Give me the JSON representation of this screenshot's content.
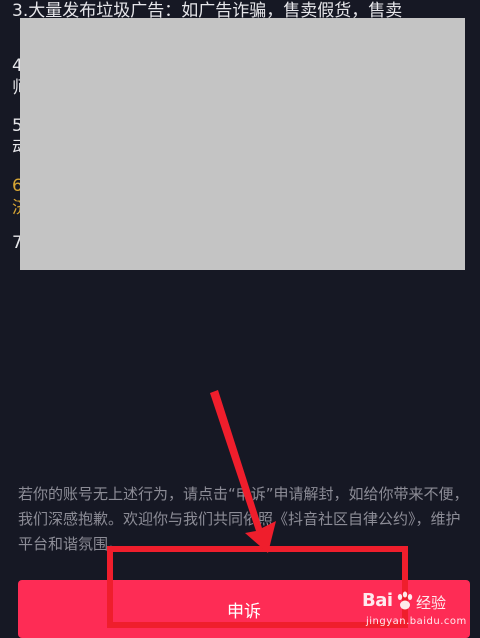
{
  "rules": {
    "line_top": "3.大量发布垃圾广告：如广告诈骗，售卖假货，售卖",
    "frag_4": "4",
    "frag_4b": "师",
    "frag_5": "5",
    "frag_5b": "动",
    "frag_6": "6",
    "frag_6b": "济",
    "frag_7": "7"
  },
  "notice": {
    "text": "若你的账号无上述行为，请点击“申诉”申请解封，如给你带来不便，我们深感抱歉。欢迎你与我们共同依照《抖音社区自律公约》，维护平台和谐氛围。"
  },
  "appeal_button": {
    "label": "申诉"
  },
  "watermark": {
    "logo": "Bai",
    "cn": "经验",
    "site": "jingyan.baidu.com"
  },
  "colors": {
    "background": "#161824",
    "button": "#fe2c55",
    "annotation_red": "#ef1e2c",
    "redaction": "#c4c4c4",
    "highlight_text": "#d6a534"
  }
}
